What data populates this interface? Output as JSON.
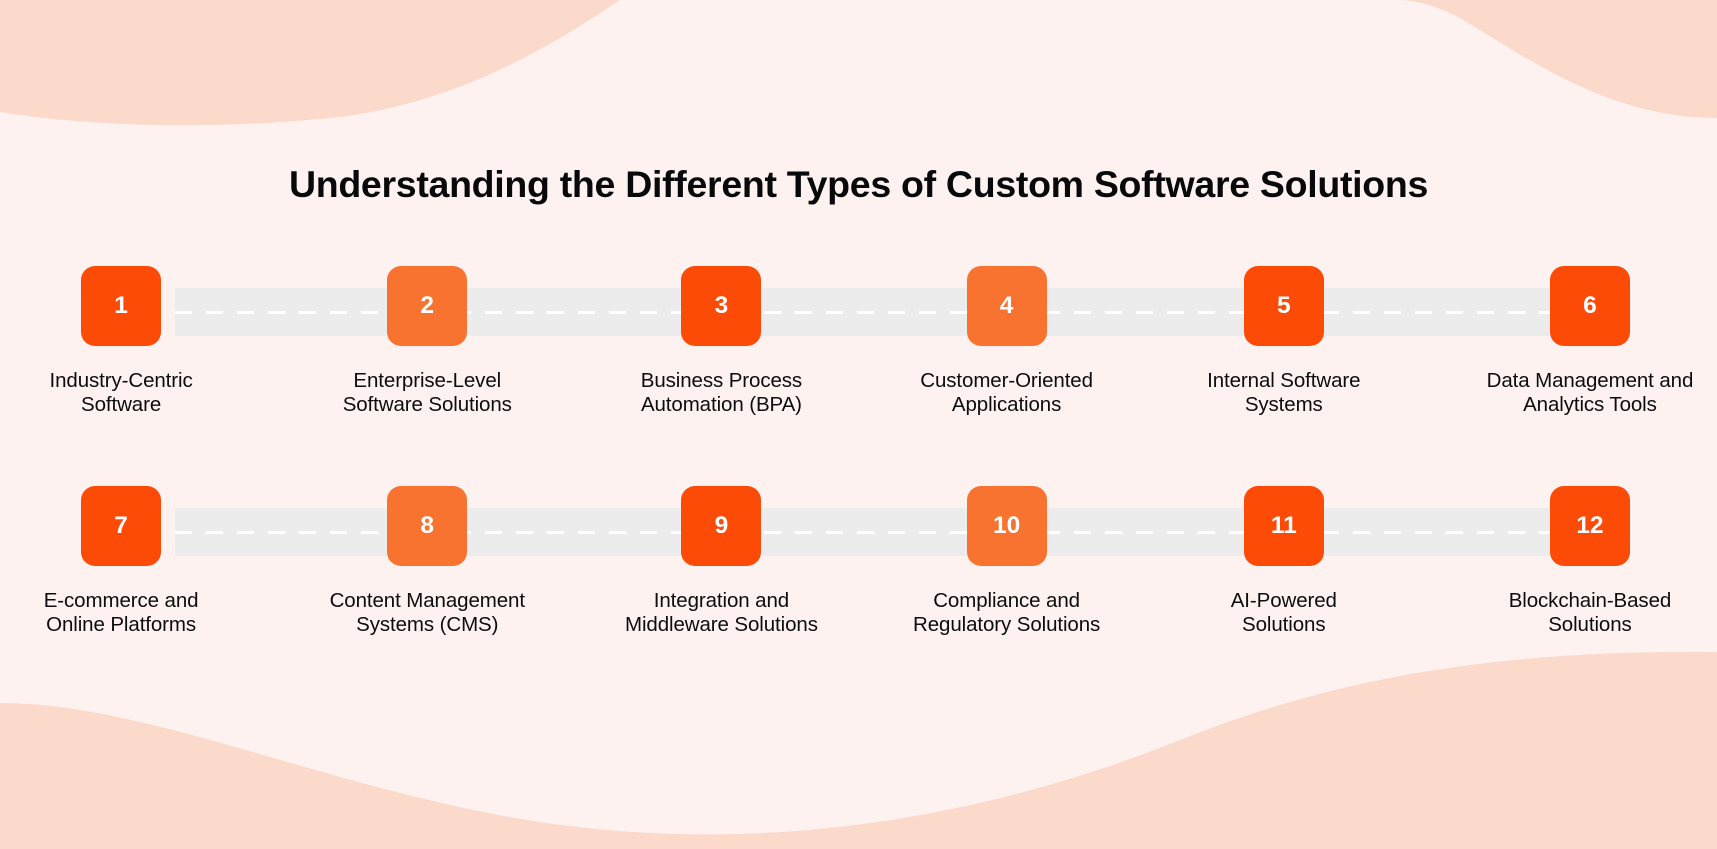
{
  "theme": {
    "background": "#FDF2EF",
    "wave": "#FBDACB",
    "connector_band": "#ECECEC",
    "connector_dash": "#FFFFFF",
    "badge_dark": "#FC4A07",
    "badge_light": "#F97330",
    "badge_text": "#FFFFFF",
    "title_color": "#08090A",
    "label_color": "#0C0D0E"
  },
  "header": {
    "title": "Understanding the Different Types of Custom Software Solutions"
  },
  "timeline": {
    "rows": [
      {
        "items": [
          {
            "number": "1",
            "label": "Industry-Centric\nSoftware",
            "shade": "dark"
          },
          {
            "number": "2",
            "label": "Enterprise-Level\nSoftware Solutions",
            "shade": "light"
          },
          {
            "number": "3",
            "label": "Business Process\nAutomation (BPA)",
            "shade": "dark"
          },
          {
            "number": "4",
            "label": "Customer-Oriented\nApplications",
            "shade": "light"
          },
          {
            "number": "5",
            "label": "Internal Software\nSystems",
            "shade": "dark"
          },
          {
            "number": "6",
            "label": "Data Management and\nAnalytics Tools",
            "shade": "dark"
          }
        ]
      },
      {
        "items": [
          {
            "number": "7",
            "label": "E-commerce and\nOnline Platforms",
            "shade": "dark"
          },
          {
            "number": "8",
            "label": "Content Management\nSystems (CMS)",
            "shade": "light"
          },
          {
            "number": "9",
            "label": "Integration and\nMiddleware Solutions",
            "shade": "dark"
          },
          {
            "number": "10",
            "label": "Compliance and\nRegulatory Solutions",
            "shade": "light"
          },
          {
            "number": "11",
            "label": "AI-Powered\nSolutions",
            "shade": "dark"
          },
          {
            "number": "12",
            "label": "Blockchain-Based\nSolutions",
            "shade": "dark"
          }
        ]
      }
    ]
  }
}
